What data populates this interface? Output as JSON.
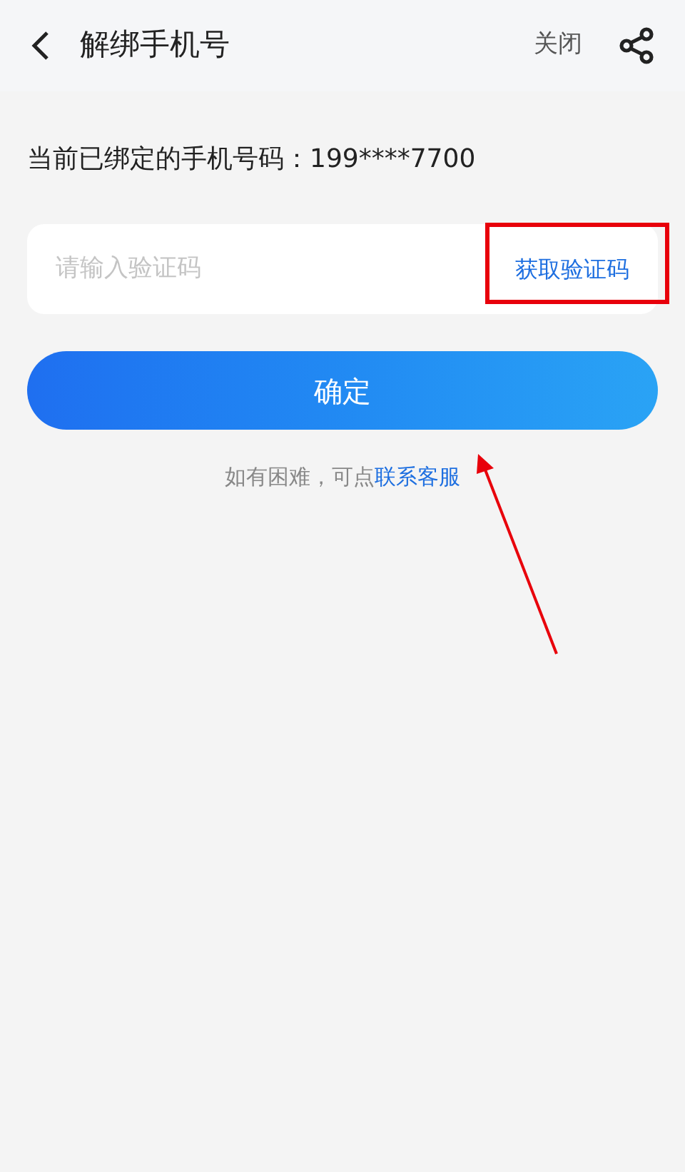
{
  "header": {
    "title": "解绑手机号",
    "close": "关闭"
  },
  "bound_phone": "当前已绑定的手机号码：199****7700",
  "code_field": {
    "placeholder": "请输入验证码",
    "get_code": "获取验证码"
  },
  "confirm_button": "确定",
  "help": {
    "text": "如有困难，可点",
    "link": "联系客服"
  }
}
